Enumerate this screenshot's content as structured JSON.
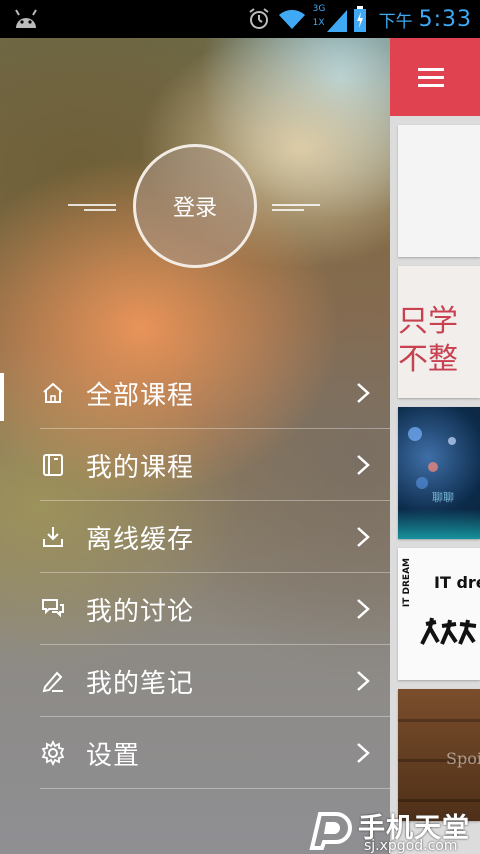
{
  "status_bar": {
    "network_label": "3G",
    "network_sub": "1X",
    "ampm": "下午",
    "time": "5:33",
    "icons": [
      "android-icon",
      "alarm-icon",
      "wifi-icon",
      "signal-icon",
      "battery-icon"
    ]
  },
  "drawer": {
    "login_label": "登录",
    "menu": [
      {
        "label": "全部课程",
        "icon": "home-icon",
        "active": true
      },
      {
        "label": "我的课程",
        "icon": "notebook-icon",
        "active": false
      },
      {
        "label": "离线缓存",
        "icon": "download-icon",
        "active": false
      },
      {
        "label": "我的讨论",
        "icon": "chat-icon",
        "active": false
      },
      {
        "label": "我的笔记",
        "icon": "pencil-icon",
        "active": false
      },
      {
        "label": "设置",
        "icon": "gear-icon",
        "active": false
      }
    ]
  },
  "content": {
    "accent_color": "#e0424f",
    "cards": [
      {
        "text": ""
      },
      {
        "text_line1": "只学",
        "text_line2": "不整"
      },
      {
        "text": "聊聊"
      },
      {
        "text": "IT dream",
        "side_text": "IT DREAM"
      },
      {
        "text": "Spoil"
      }
    ]
  },
  "watermark": {
    "main": "手机天堂",
    "sub": "sj.xpgod.com"
  }
}
